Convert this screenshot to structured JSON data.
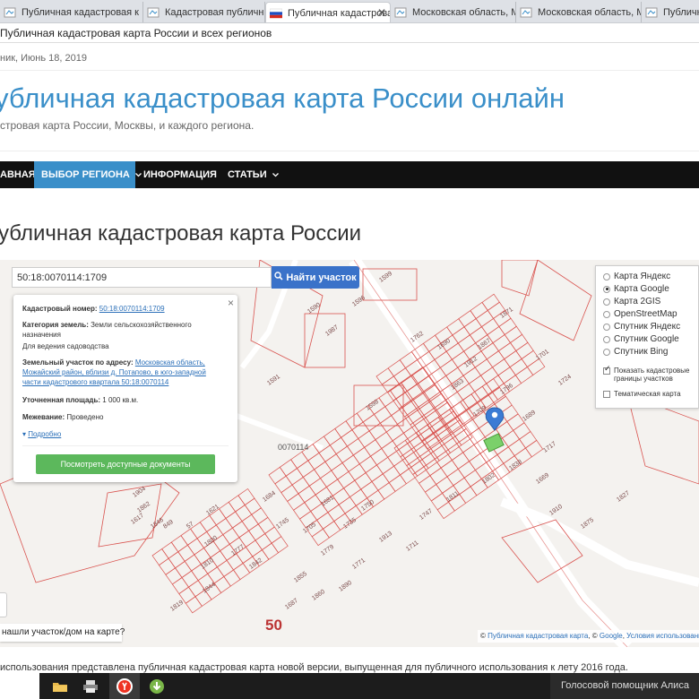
{
  "browser": {
    "tabs": [
      {
        "label": "Публичная кадастровая к",
        "active": false
      },
      {
        "label": "Кадастровая публичная к",
        "active": false
      },
      {
        "label": "Публичная кадастрова",
        "active": true
      },
      {
        "label": "Московская область, Мо",
        "active": false
      },
      {
        "label": "Московская область, Мо",
        "active": false
      },
      {
        "label": "Публичная",
        "active": false
      }
    ],
    "close_glyph": "✕",
    "page_title": "Публичная кадастровая карта России и всех регионов"
  },
  "header": {
    "date": "ник, Июнь 18, 2019",
    "site_title": "убличная кадастровая карта России онлайн",
    "site_description": "стровая карта России, Москвы, и каждого региона."
  },
  "nav": {
    "items": [
      {
        "label": "АВНАЯ",
        "active": false
      },
      {
        "label": "ВЫБОР РЕГИОНА",
        "active": true,
        "dropdown": true
      },
      {
        "label": "ИНФОРМАЦИЯ",
        "active": false
      },
      {
        "label": "СТАТЬИ",
        "active": false,
        "dropdown": true
      }
    ],
    "chevron": "⌄"
  },
  "page": {
    "title": "убличная кадастровая карта России",
    "footnote": "использования представлена публичная кадастровая карта новой версии, выпущенная для публичного использования к лету 2016 года."
  },
  "map": {
    "search_value": "50:18:0070114:1709",
    "search_button": "Найти участок",
    "popup": {
      "close": "×",
      "cadastral_label": "Кадастровый номер:",
      "cadastral_value": "50:18:0070114:1709",
      "category_label": "Категория земель:",
      "category_value": "Земли сельскохозяйственного назначения",
      "use_value": "Для ведения садоводства",
      "address_label": "Земельный участок по адресу:",
      "address_value": "Московская область, Можайский район, вблизи д. Потапово, в юго-западной части кадастрового квартала 50:18:0070114",
      "area_label": "Уточненная площадь:",
      "area_value": "1 000 кв.м.",
      "survey_label": "Межевание:",
      "survey_value": "Проведено",
      "more_link": "Подробно",
      "docs_button": "Посмотреть доступные документы"
    },
    "layers": {
      "options": [
        {
          "label": "Карта Яндекс",
          "selected": false
        },
        {
          "label": "Карта Google",
          "selected": true
        },
        {
          "label": "Карта 2GIS",
          "selected": false
        },
        {
          "label": "OpenStreetMap",
          "selected": false
        },
        {
          "label": "Спутник Яндекс",
          "selected": false
        },
        {
          "label": "Спутник Google",
          "selected": false
        },
        {
          "label": "Спутник Bing",
          "selected": false
        }
      ],
      "show_borders_label": "Показать кадастровые границы участков",
      "show_borders_checked": true,
      "thematic_label": "Тематическая карта",
      "thematic_checked": false
    },
    "quarter_label": "0070114",
    "zoom_label": "50",
    "not_found_prompt": "нашли участок/дом на карте?",
    "attribution": {
      "prefix": "©",
      "link1": "Публичная кадастровая карта",
      "sep": ", ©",
      "link2": "Google",
      "link3": "Условия использования"
    },
    "parcel_labels": [
      "1599",
      "1598",
      "1596",
      "1709",
      "1591",
      "1590",
      "1987",
      "1023",
      "1617",
      "1621",
      "1810",
      "1819",
      "1844",
      "1711",
      "1910",
      "1717",
      "1689",
      "1796",
      "1912",
      "1690",
      "1762",
      "1724",
      "1701",
      "1735",
      "1750",
      "1705",
      "1745",
      "1684",
      "1863",
      "1867",
      "1871",
      "1875",
      "1827",
      "1855",
      "1842",
      "1777",
      "1779",
      "1771",
      "1913",
      "1747",
      "1811",
      "1802",
      "1838",
      "1669",
      "1681",
      "1800",
      "1904",
      "1862",
      "1846",
      "849",
      "57",
      "1687",
      "1860",
      "1890"
    ],
    "colors": {
      "background": "#f4f2ef",
      "parcel_line": "#d9534f",
      "road": "#ffffff",
      "marker": "#3b7bd4",
      "selected_parcel": "#7bd06a"
    }
  },
  "taskbar": {
    "apps": [
      "folder-icon",
      "printer-icon",
      "yandex-browser-icon",
      "torrent-icon"
    ],
    "alice_label": "Голосовой помощник Алиса"
  }
}
